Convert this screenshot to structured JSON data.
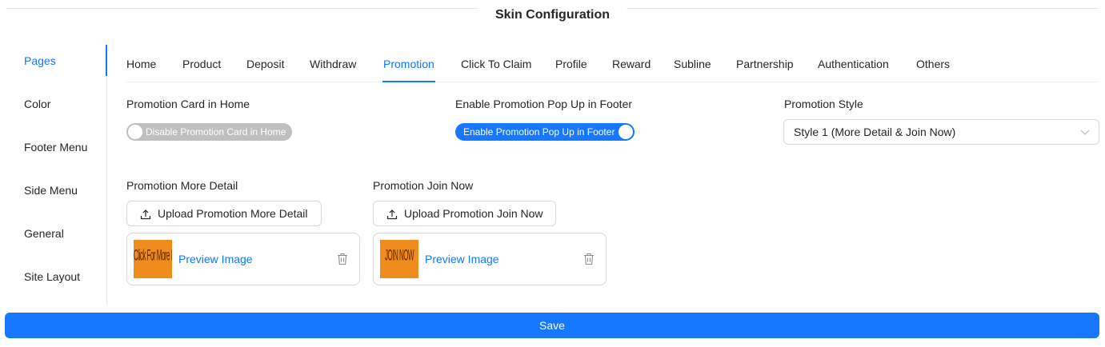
{
  "page": {
    "title": "Skin Configuration"
  },
  "sidebar": {
    "items": [
      {
        "label": "Pages",
        "active": true
      },
      {
        "label": "Color"
      },
      {
        "label": "Footer Menu"
      },
      {
        "label": "Side Menu"
      },
      {
        "label": "General"
      },
      {
        "label": "Site Layout"
      }
    ]
  },
  "tabs": [
    {
      "label": "Home"
    },
    {
      "label": "Product"
    },
    {
      "label": "Deposit"
    },
    {
      "label": "Withdraw"
    },
    {
      "label": "Promotion",
      "active": true
    },
    {
      "label": "Click To Claim"
    },
    {
      "label": "Profile"
    },
    {
      "label": "Reward"
    },
    {
      "label": "Subline"
    },
    {
      "label": "Partnership"
    },
    {
      "label": "Authentication"
    },
    {
      "label": "Others"
    }
  ],
  "form": {
    "promo_card_home": {
      "label": "Promotion Card in Home",
      "switch_text": "Disable Promotion Card in Home",
      "checked": false
    },
    "promo_popup_footer": {
      "label": "Enable Promotion Pop Up in Footer",
      "switch_text": "Enable Promotion Pop Up in Footer",
      "checked": true
    },
    "promo_style": {
      "label": "Promotion Style",
      "value": "Style 1 (More Detail & Join Now)"
    },
    "more_detail": {
      "label": "Promotion More Detail",
      "upload_label": "Upload Promotion More Detail",
      "preview_label": "Preview Image",
      "thumb_text": "Click For More Info"
    },
    "join_now": {
      "label": "Promotion Join Now",
      "upload_label": "Upload Promotion Join Now",
      "preview_label": "Preview Image",
      "thumb_text": "JOIN NOW"
    }
  },
  "actions": {
    "save_label": "Save"
  },
  "colors": {
    "accent": "#1677ff",
    "thumb": "#f08c1c",
    "switch_off": "#bfbfbf"
  }
}
